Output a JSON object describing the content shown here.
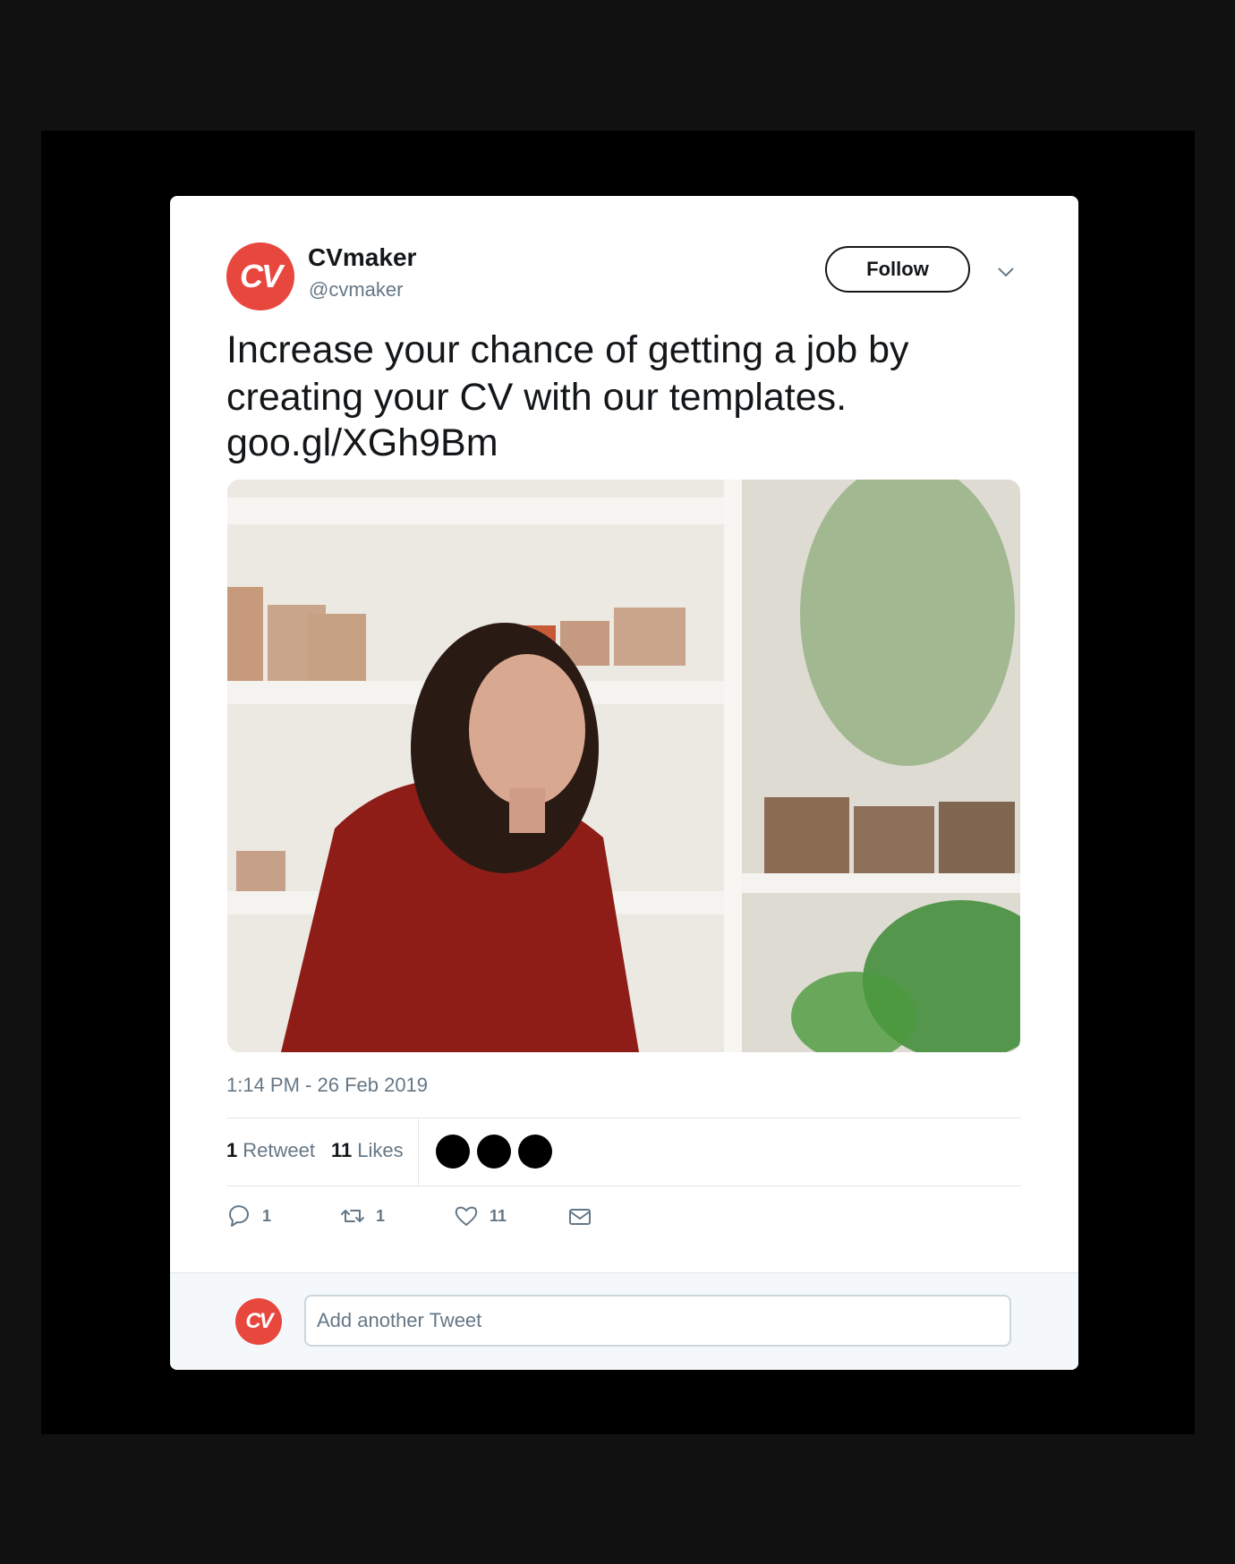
{
  "tweet": {
    "author": {
      "avatar_text": "CV",
      "display_name": "CVmaker",
      "handle": "@cvmaker"
    },
    "follow_label": "Follow",
    "text": "Increase your chance of getting a job by creating your CV with our templates.",
    "link": "goo.gl/XGh9Bm",
    "timestamp": "1:14 PM - 26 Feb 2019",
    "stats": {
      "retweets_count": "1",
      "retweets_label": "Retweet",
      "likes_count": "11",
      "likes_label": "Likes"
    },
    "actions": {
      "reply_count": "1",
      "retweet_count": "1",
      "like_count": "11"
    }
  },
  "compose": {
    "avatar_text": "CV",
    "placeholder": "Add another Tweet"
  },
  "colors": {
    "brand": "#e8473e",
    "text_primary": "#14171a",
    "text_secondary": "#657786"
  },
  "icons": [
    "chevron-down-icon",
    "reply-icon",
    "retweet-icon",
    "heart-icon",
    "message-icon"
  ]
}
